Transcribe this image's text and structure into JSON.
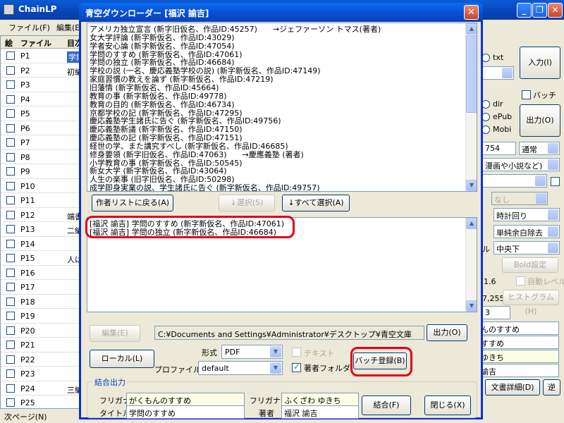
{
  "main_window": {
    "title": "ChainLP",
    "menu": [
      "ファイル(F)",
      "編集(E)"
    ],
    "grid_headers": [
      "絵",
      "ファイル",
      "目次"
    ],
    "rows": [
      {
        "id": "P1",
        "text": "学問"
      },
      {
        "id": "P2",
        "text": "初編"
      },
      {
        "id": "P3",
        "text": ""
      },
      {
        "id": "P4",
        "text": ""
      },
      {
        "id": "P5",
        "text": ""
      },
      {
        "id": "P6",
        "text": ""
      },
      {
        "id": "P7",
        "text": ""
      },
      {
        "id": "P8",
        "text": ""
      },
      {
        "id": "P9",
        "text": ""
      },
      {
        "id": "P10",
        "text": ""
      },
      {
        "id": "P11",
        "text": ""
      },
      {
        "id": "P12",
        "text": "端書"
      },
      {
        "id": "P13",
        "text": "二編"
      },
      {
        "id": "P14",
        "text": ""
      },
      {
        "id": "P15",
        "text": "人は"
      },
      {
        "id": "P16",
        "text": ""
      },
      {
        "id": "P17",
        "text": ""
      },
      {
        "id": "P18",
        "text": ""
      },
      {
        "id": "P19",
        "text": ""
      },
      {
        "id": "P20",
        "text": ""
      },
      {
        "id": "P21",
        "text": ""
      },
      {
        "id": "P22",
        "text": ""
      },
      {
        "id": "P23",
        "text": ""
      },
      {
        "id": "P24",
        "text": "三編"
      },
      {
        "id": "P25",
        "text": ""
      }
    ],
    "status": "次ページ(N)",
    "right_panel": {
      "radio_txt": "txt",
      "input_button": "入力(I)",
      "batch_check": "バッチ",
      "radio_dir": "dir",
      "radio_epub": "ePub",
      "radio_mobi": "Mobi",
      "output_button": "出力(O)",
      "height_value": "754",
      "mode_select": "通常",
      "type_select": "漫画や小説など)",
      "none_select": "なし",
      "rotation_select": "時計回り",
      "margin_select": "単純余白除去",
      "align_label": "ル",
      "align_select": "中央下",
      "bold_button": "Bold設定",
      "auto_level": "自動レベル",
      "num_1_6": "1.6",
      "num_7255": "7,255",
      "histogram_button": "ヒストグラム(H)",
      "num_3": "3",
      "title_field": "んのすすめ",
      "title_field2": "すすめ",
      "author_kana": "ゆきち",
      "author_field": "諭吉",
      "details_button": "文書詳細(D)",
      "reverse_button": "逆"
    }
  },
  "dialog": {
    "title": "青空ダウンローダー [福沢 諭吉]",
    "close": "✕",
    "books": [
      "アメリカ独立宣言 (新字旧仮名、作品ID:45257)　　→ジェファーソン トマス(著者)",
      "女大学評論 (新字新仮名、作品ID:43029)",
      "学者安心論 (新字新仮名、作品ID:47054)",
      "学問のすすめ (新字新仮名、作品ID:47061)",
      "学問の独立 (新字新仮名、作品ID:46684)",
      "学校の説 (一名、慶応義塾学校の説) (新字新仮名、作品ID:47149)",
      "家庭習慣の教えを論ず (新字新仮名、作品ID:47219)",
      "旧藩情 (新字新仮名、作品ID:45664)",
      "教育の事 (新字新仮名、作品ID:49778)",
      "教育の目的 (新字新仮名、作品ID:46734)",
      "京都学校の記 (新字新仮名、作品ID:47295)",
      "慶応義塾学生諸氏に告ぐ (新字新仮名、作品ID:49756)",
      "慶応義塾新議 (新字新仮名、作品ID:47150)",
      "慶応義塾の記 (新字新仮名、作品ID:47151)",
      "経世の学、また講究すべし (新字新仮名、作品ID:46685)",
      "修身要領 (新字旧仮名、作品ID:47063)　　→慶應義塾 (著者)",
      "小学教育の事 (新字新仮名、作品ID:50545)",
      "新女大学 (新字新仮名、作品ID:43064)",
      "人生の楽事 (旧字旧仮名、作品ID:50298)",
      "成学即身実業の説、学生諸氏に告ぐ (新字新仮名、作品ID:49757)"
    ],
    "btn_back": "作者リストに戻る(A)",
    "btn_select": "↓選択(S)",
    "btn_select_all": "↓すべて選択(A)",
    "selected": [
      "[福沢 諭吉] 学問のすすめ (新字新仮名、作品ID:47061)",
      "[福沢 諭吉] 学問の独立 (新字新仮名、作品ID:46684)"
    ],
    "btn_edit": "編集(E)",
    "path": "C:¥Documents and Settings¥Administrator¥デスクトップ¥青空文庫",
    "btn_output": "出力(O)",
    "btn_local": "ローカル(L)",
    "format_label": "形式",
    "format_value": "PDF",
    "text_check": "テキスト",
    "profile_label": "プロファイル",
    "profile_value": "default",
    "author_folder_check": "著者フォルダ",
    "btn_batch": "バッチ登録(B)",
    "group_caption": "結合出力",
    "furigana_label": "フリガナ",
    "title_kana": "がくもんのすすめ",
    "title_label": "タイトル",
    "title_value": "学問のすすめ",
    "furigana_label2": "フリガナ",
    "author_kana": "ふくざわ ゆきち",
    "author_label": "著者",
    "author_value": "福沢 諭吉",
    "btn_join": "結合(F)",
    "btn_close": "閉じる(X)",
    "highlight_color": "#e0001a"
  }
}
